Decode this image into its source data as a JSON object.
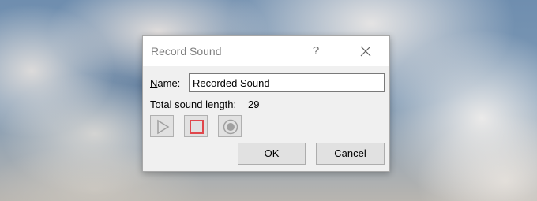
{
  "dialog": {
    "title": "Record Sound",
    "help_label": "?",
    "name_label_accel": "N",
    "name_label_rest": "ame:",
    "name_value": "Recorded Sound",
    "length_label": "Total sound length:",
    "length_value": "29",
    "ok_label": "OK",
    "cancel_label": "Cancel"
  },
  "icons": {
    "play": "play-icon",
    "stop": "stop-icon",
    "record": "record-icon",
    "close": "close-icon"
  },
  "colors": {
    "stop_accent": "#e0474c",
    "disabled_icon": "#a0a0a0",
    "title_text": "#808080"
  }
}
